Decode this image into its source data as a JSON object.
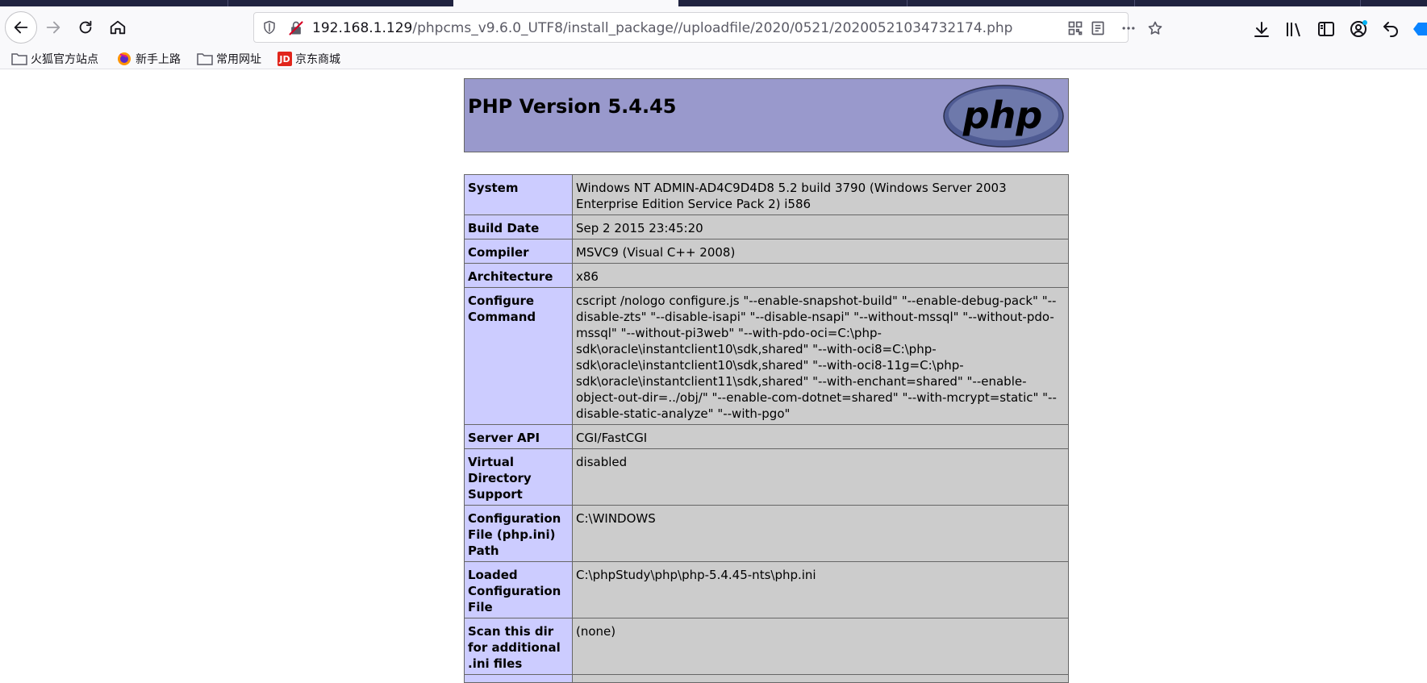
{
  "browser": {
    "url_host": "192.168.1.129",
    "url_path": "/phpcms_v9.6.0_UTF8/install_package//uploadfile/2020/0521/20200521034732174.php",
    "bookmarks": [
      "火狐官方站点",
      "新手上路",
      "常用网址",
      "京东商城"
    ],
    "bookmark_jd_badge": "JD"
  },
  "page": {
    "title": "PHP Version 5.4.45",
    "logo_text": "php",
    "rows": [
      {
        "key": "System",
        "value": "Windows NT ADMIN-AD4C9D4D8 5.2 build 3790 (Windows Server 2003 Enterprise Edition Service Pack 2) i586"
      },
      {
        "key": "Build Date",
        "value": "Sep 2 2015 23:45:20"
      },
      {
        "key": "Compiler",
        "value": "MSVC9 (Visual C++ 2008)"
      },
      {
        "key": "Architecture",
        "value": "x86"
      },
      {
        "key": "Configure Command",
        "value": "cscript /nologo configure.js \"--enable-snapshot-build\" \"--enable-debug-pack\" \"--disable-zts\" \"--disable-isapi\" \"--disable-nsapi\" \"--without-mssql\" \"--without-pdo-mssql\" \"--without-pi3web\" \"--with-pdo-oci=C:\\php-sdk\\oracle\\instantclient10\\sdk,shared\" \"--with-oci8=C:\\php-sdk\\oracle\\instantclient10\\sdk,shared\" \"--with-oci8-11g=C:\\php-sdk\\oracle\\instantclient11\\sdk,shared\" \"--with-enchant=shared\" \"--enable-object-out-dir=../obj/\" \"--enable-com-dotnet=shared\" \"--with-mcrypt=static\" \"--disable-static-analyze\" \"--with-pgo\""
      },
      {
        "key": "Server API",
        "value": "CGI/FastCGI"
      },
      {
        "key": "Virtual Directory Support",
        "value": "disabled"
      },
      {
        "key": "Configuration File (php.ini) Path",
        "value": "C:\\WINDOWS"
      },
      {
        "key": "Loaded Configuration File",
        "value": "C:\\phpStudy\\php\\php-5.4.45-nts\\php.ini"
      },
      {
        "key": "Scan this dir for additional .ini files",
        "value": "(none)"
      },
      {
        "key": "",
        "value": ""
      }
    ]
  }
}
